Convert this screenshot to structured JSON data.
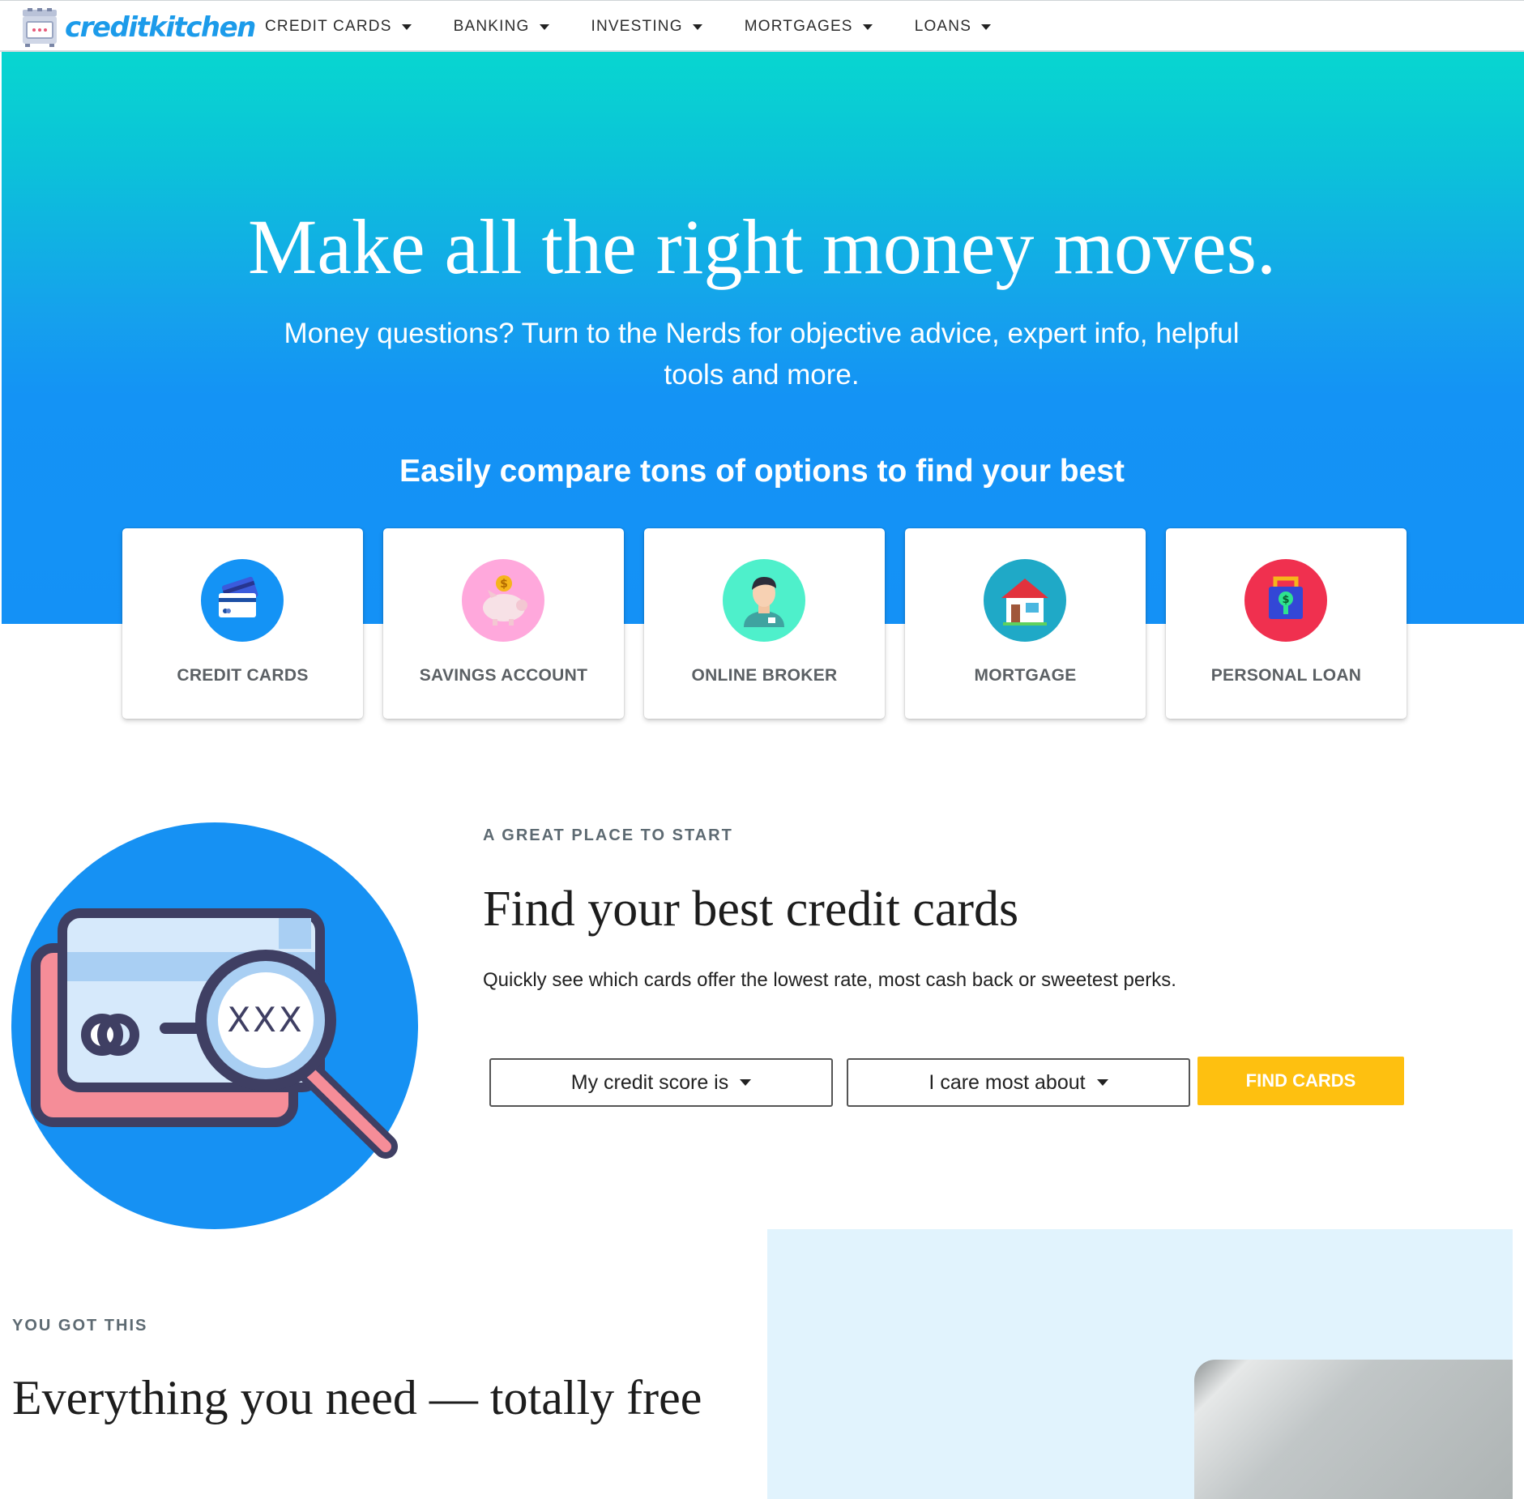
{
  "brand": {
    "logo_text": "creditkitchen"
  },
  "nav": {
    "items": [
      {
        "label": "CREDIT CARDS"
      },
      {
        "label": "BANKING"
      },
      {
        "label": "INVESTING"
      },
      {
        "label": "MORTGAGES"
      },
      {
        "label": "LOANS"
      }
    ]
  },
  "hero": {
    "title": "Make all the right money moves.",
    "subtitle": "Money questions? Turn to the Nerds for objective advice, expert info, helpful tools and more.",
    "compare_heading": "Easily compare tons of options to find your best"
  },
  "options": [
    {
      "label": "CREDIT CARDS",
      "icon": "credit-cards-icon",
      "color": "#1493f5"
    },
    {
      "label": "SAVINGS ACCOUNT",
      "icon": "piggy-bank-icon",
      "color": "#ffa8dc"
    },
    {
      "label": "ONLINE BROKER",
      "icon": "broker-person-icon",
      "color": "#4ef0cb"
    },
    {
      "label": "MORTGAGE",
      "icon": "house-icon",
      "color": "#1fa9c7"
    },
    {
      "label": "PERSONAL LOAN",
      "icon": "money-bag-icon",
      "color": "#f0304f"
    }
  ],
  "find_cards": {
    "eyebrow": "A GREAT PLACE TO START",
    "title": "Find your best credit cards",
    "description": "Quickly see which cards offer the lowest rate, most cash back or sweetest perks.",
    "illustration_text": "XXX",
    "credit_score_select": "My credit score is",
    "priority_select": "I care most about",
    "button_label": "FIND CARDS"
  },
  "bottom": {
    "eyebrow": "YOU GOT THIS",
    "title": "Everything you need — totally free"
  },
  "colors": {
    "brand_blue": "#1c9bea",
    "hero_teal": "#08d6d0",
    "hero_blue": "#1491f6",
    "cta_yellow": "#fec010",
    "promo_bg": "#e1f3fd"
  }
}
